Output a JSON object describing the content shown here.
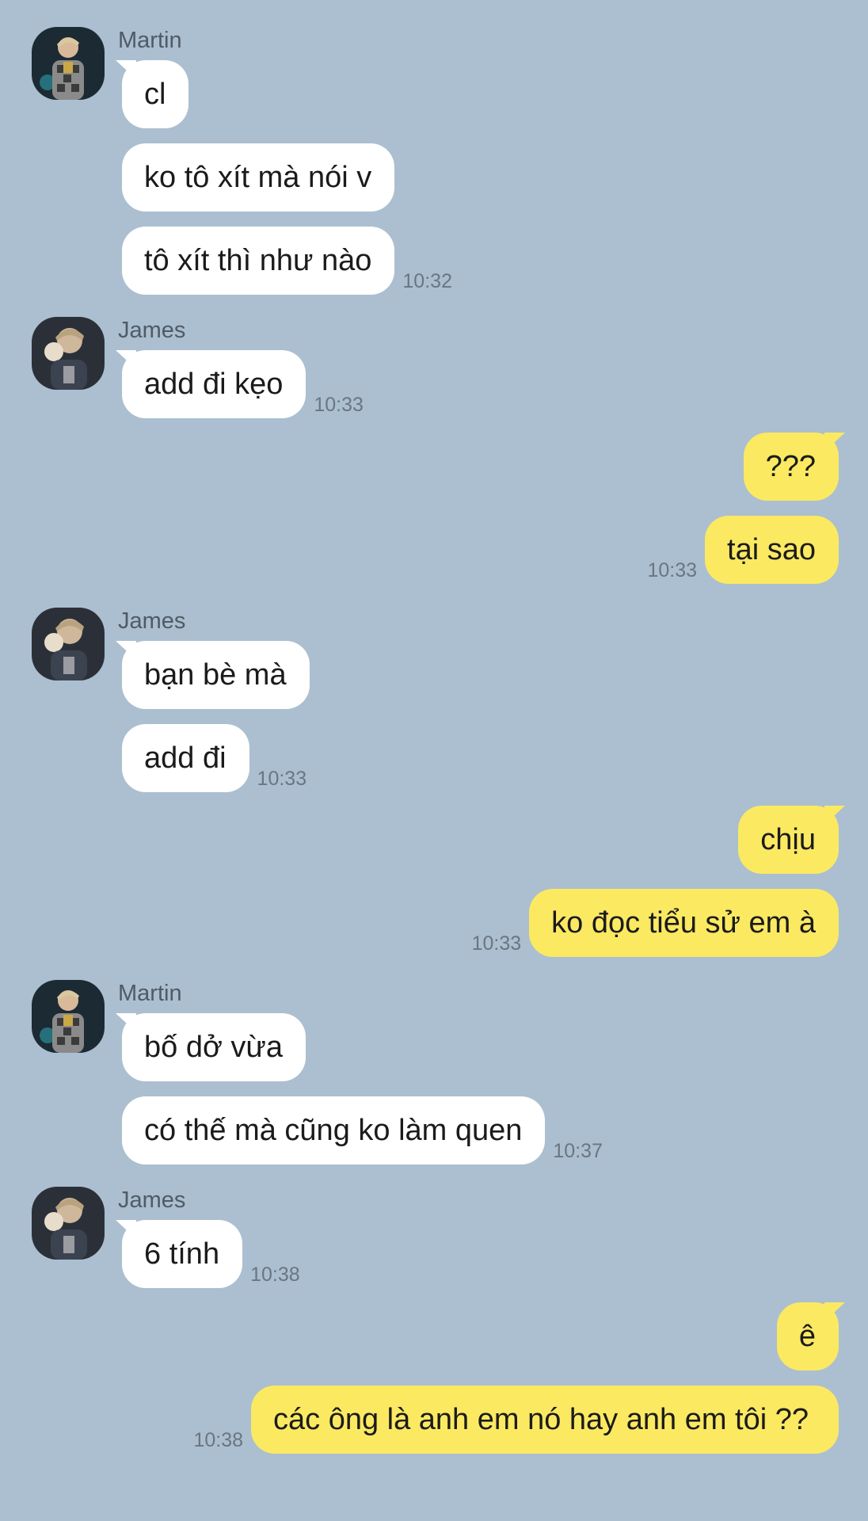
{
  "colors": {
    "background": "#abbfd0",
    "incoming_bubble": "#ffffff",
    "outgoing_bubble": "#fbe962",
    "sender_name": "#4f5b66",
    "timestamp": "#6b7682"
  },
  "messages": [
    {
      "sender": "Martin",
      "avatar_icon": "user-avatar-icon",
      "bubbles": [
        "cl",
        "ko tô xít mà nói v",
        "tô xít thì như nào"
      ],
      "time": "10:32"
    },
    {
      "sender": "James",
      "avatar_icon": "user-avatar-icon",
      "bubbles": [
        "add đi kẹo"
      ],
      "time": "10:33"
    },
    {
      "sender": "me",
      "bubbles": [
        "???",
        "tại sao"
      ],
      "time": "10:33"
    },
    {
      "sender": "James",
      "avatar_icon": "user-avatar-icon",
      "bubbles": [
        "bạn bè mà",
        "add đi"
      ],
      "time": "10:33"
    },
    {
      "sender": "me",
      "bubbles": [
        "chịu",
        "ko đọc tiểu sử em à"
      ],
      "time": "10:33"
    },
    {
      "sender": "Martin",
      "avatar_icon": "user-avatar-icon",
      "bubbles": [
        "bố dở vừa",
        "có thế mà cũng ko làm quen"
      ],
      "time": "10:37"
    },
    {
      "sender": "James",
      "avatar_icon": "user-avatar-icon",
      "bubbles": [
        "6 tính"
      ],
      "time": "10:38"
    },
    {
      "sender": "me",
      "bubbles": [
        "ê",
        "các ông là anh em nó hay anh em tôi ??"
      ],
      "time": "10:38"
    }
  ]
}
